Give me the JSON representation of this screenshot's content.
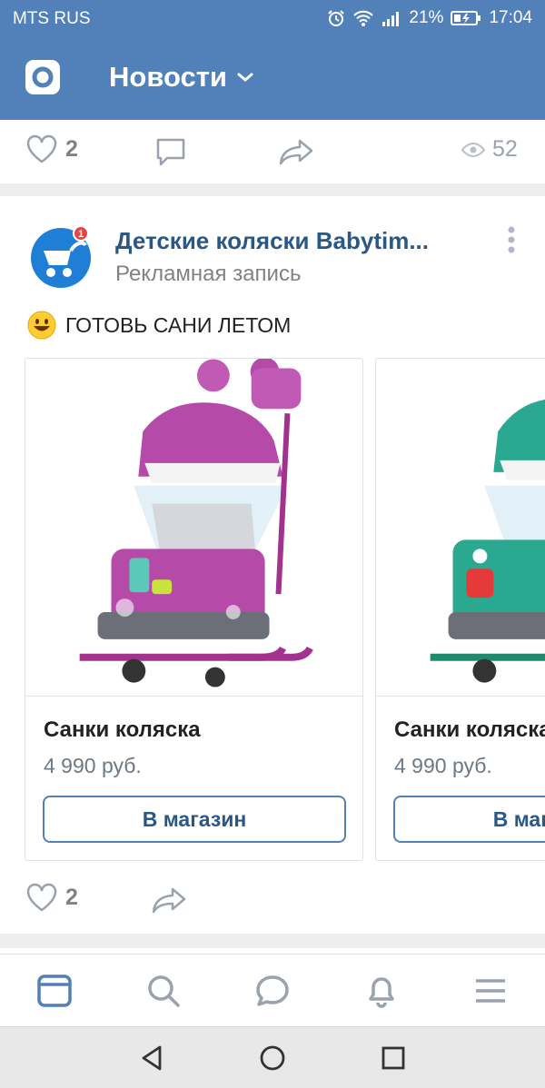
{
  "status_bar": {
    "carrier": "MTS RUS",
    "battery": "21%",
    "time": "17:04"
  },
  "header": {
    "title": "Новости"
  },
  "prev_post": {
    "likes": "2",
    "views": "52"
  },
  "post": {
    "author": "Детские коляски Babytim...",
    "subtitle": "Рекламная запись",
    "text": "ГОТОВЬ САНИ ЛЕТОМ",
    "likes": "2",
    "products": [
      {
        "name": "Санки коляска",
        "price": "4 990 руб.",
        "button": "В магазин",
        "color": "#b54aa8"
      },
      {
        "name": "Санки коляска",
        "price": "4 990 руб.",
        "button": "В магазин",
        "color": "#2aa890"
      }
    ]
  },
  "tabbar": {
    "items": [
      "news-tab",
      "search-tab",
      "messages-tab",
      "notifications-tab",
      "menu-tab"
    ]
  },
  "colors": {
    "brand": "#5181b8",
    "link": "#2a5885",
    "secondary": "#828282"
  }
}
